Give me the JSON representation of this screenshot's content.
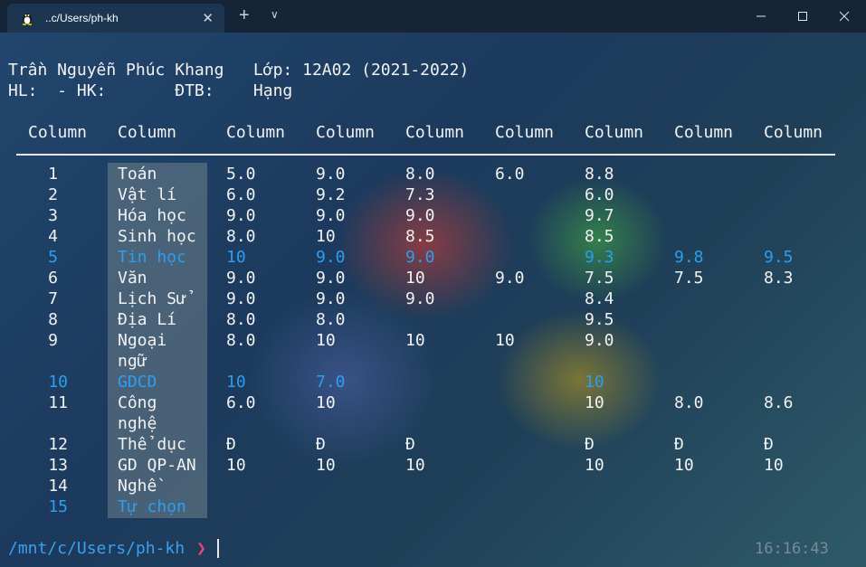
{
  "window": {
    "tab_title": "..c/Users/ph-kh",
    "tab_icon": "linux-penguin-icon",
    "new_tab_label": "+",
    "dropdown_label": "∨",
    "minimize_label": "—",
    "maximize_label": "☐",
    "close_label": "✕",
    "tab_close_label": "✕"
  },
  "header": {
    "line1": "Trần Nguyễn Phúc Khang   Lớp: 12A02 (2021-2022)",
    "line2": "HL:  - HK:       ĐTB:    Hạng"
  },
  "table": {
    "columns": [
      "Column",
      "Column",
      "Column",
      "Column",
      "Column",
      "Column",
      "Column",
      "Column",
      "Column"
    ],
    "rows": [
      {
        "no": "1",
        "subject": [
          "Toán"
        ],
        "scores": [
          "5.0",
          "9.0",
          "8.0",
          "6.0",
          "8.8",
          "",
          ""
        ],
        "highlight": false
      },
      {
        "no": "2",
        "subject": [
          "Vật lí"
        ],
        "scores": [
          "6.0",
          "9.2",
          "7.3",
          "",
          "6.0",
          "",
          ""
        ],
        "highlight": false
      },
      {
        "no": "3",
        "subject": [
          "Hóa học"
        ],
        "scores": [
          "9.0",
          "9.0",
          "9.0",
          "",
          "9.7",
          "",
          ""
        ],
        "highlight": false
      },
      {
        "no": "4",
        "subject": [
          "Sinh học"
        ],
        "scores": [
          "8.0",
          "10",
          "8.5",
          "",
          "8.5",
          "",
          ""
        ],
        "highlight": false
      },
      {
        "no": "5",
        "subject": [
          "Tin học"
        ],
        "scores": [
          "10",
          "9.0",
          "9.0",
          "",
          "9.3",
          "9.8",
          "9.5"
        ],
        "highlight": true
      },
      {
        "no": "6",
        "subject": [
          "Văn"
        ],
        "scores": [
          "9.0",
          "9.0",
          "10",
          "9.0",
          "7.5",
          "7.5",
          "8.3"
        ],
        "highlight": false
      },
      {
        "no": "7",
        "subject": [
          "Lịch Sử"
        ],
        "scores": [
          "9.0",
          "9.0",
          "9.0",
          "",
          "8.4",
          "",
          ""
        ],
        "highlight": false
      },
      {
        "no": "8",
        "subject": [
          "Địa Lí"
        ],
        "scores": [
          "8.0",
          "8.0",
          "",
          "",
          "9.5",
          "",
          ""
        ],
        "highlight": false
      },
      {
        "no": "9",
        "subject": [
          "Ngoại",
          "ngữ"
        ],
        "scores": [
          "8.0",
          "10",
          "10",
          "10",
          "9.0",
          "",
          ""
        ],
        "highlight": false
      },
      {
        "no": "10",
        "subject": [
          "GDCD"
        ],
        "scores": [
          "10",
          "7.0",
          "",
          "",
          "10",
          "",
          ""
        ],
        "highlight": true
      },
      {
        "no": "11",
        "subject": [
          "Công",
          "nghệ"
        ],
        "scores": [
          "6.0",
          "10",
          "",
          "",
          "10",
          "8.0",
          "8.6"
        ],
        "highlight": false
      },
      {
        "no": "12",
        "subject": [
          "Thể dục"
        ],
        "scores": [
          "Đ",
          "Đ",
          "Đ",
          "",
          "Đ",
          "Đ",
          "Đ"
        ],
        "highlight": false
      },
      {
        "no": "13",
        "subject": [
          "GD QP-AN"
        ],
        "scores": [
          "10",
          "10",
          "10",
          "",
          "10",
          "10",
          "10"
        ],
        "highlight": false
      },
      {
        "no": "14",
        "subject": [
          "Nghề"
        ],
        "scores": [
          "",
          "",
          "",
          "",
          "",
          "",
          ""
        ],
        "highlight": false
      },
      {
        "no": "15",
        "subject": [
          "Tự chọn"
        ],
        "scores": [
          "",
          "",
          "",
          "",
          "",
          "",
          ""
        ],
        "highlight": true
      }
    ]
  },
  "prompt": {
    "path": "/mnt/c/Users/ph-kh",
    "symbol": "❯",
    "clock": "16:16:43"
  },
  "colors": {
    "highlight": "#2b9ff2",
    "prompt_path": "#3aa0ef",
    "prompt_symbol": "#e8457a"
  }
}
